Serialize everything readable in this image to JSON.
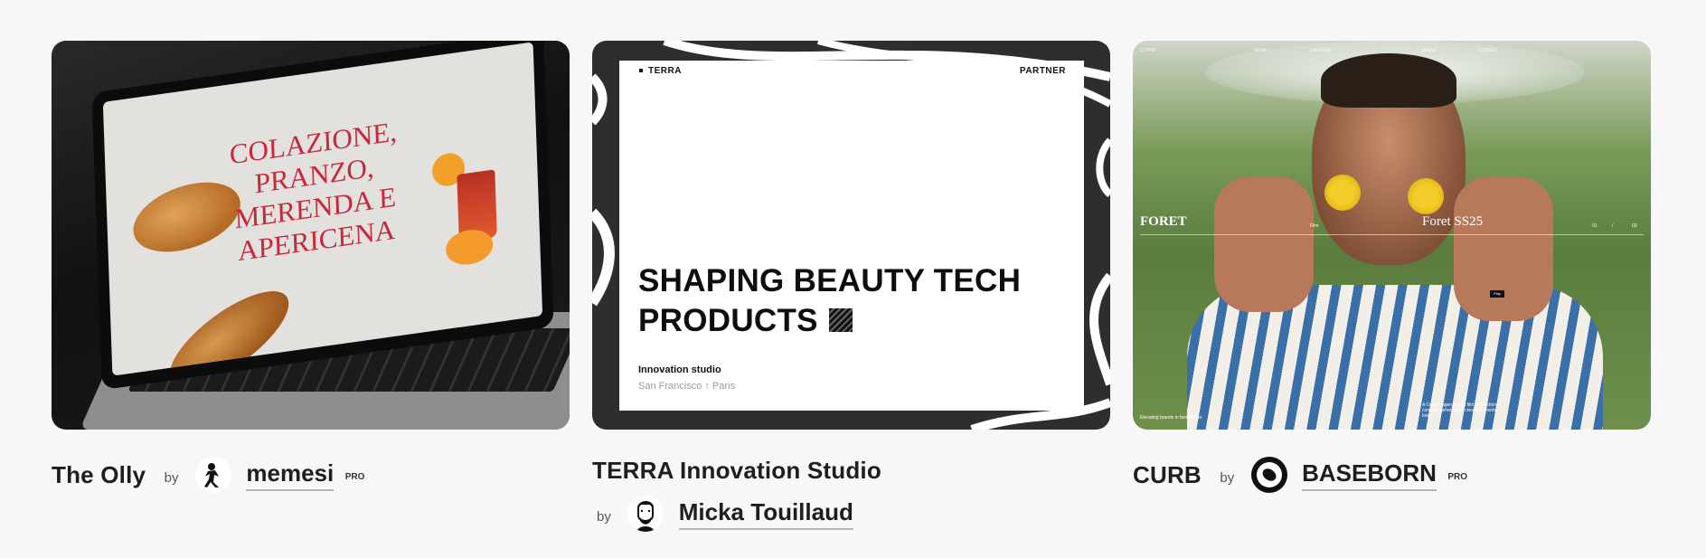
{
  "cards": [
    {
      "title": "The Olly",
      "by": "by",
      "author": "memesi",
      "badge": "PRO",
      "screen": {
        "headline": "COLAZIONE, PRANZO, MERENDA e APERICENA"
      }
    },
    {
      "title": "TERRA Innovation Studio",
      "by": "by",
      "author": "Micka Touillaud",
      "screen": {
        "brand": "TERRA",
        "partner": "PARTNER",
        "hero_line1": "SHAPING BEAUTY TECH",
        "hero_line2": "PRODUCTS",
        "studio": "Innovation studio",
        "city": "San Francisco ↑ Paris"
      }
    },
    {
      "title": "CURB",
      "by": "by",
      "author": "BASEBORN",
      "badge": "PRO",
      "screen": {
        "brand": "FORET",
        "collection": "Foret SS25",
        "nav": [
          "CURB",
          "Work",
          "Services",
          "About",
          "Contact"
        ],
        "play": "Play",
        "film": "Film",
        "counter": [
          "01",
          "/",
          "03"
        ],
        "footer_left": "Elevating brands in fast motion",
        "footer_right": "A Copenhagen based film production company where fluid creativity meets bold"
      }
    }
  ],
  "colors": {
    "background": "#f7f7f7",
    "terra_frame": "#2e2e2e",
    "olly_accent": "#c8283c"
  }
}
